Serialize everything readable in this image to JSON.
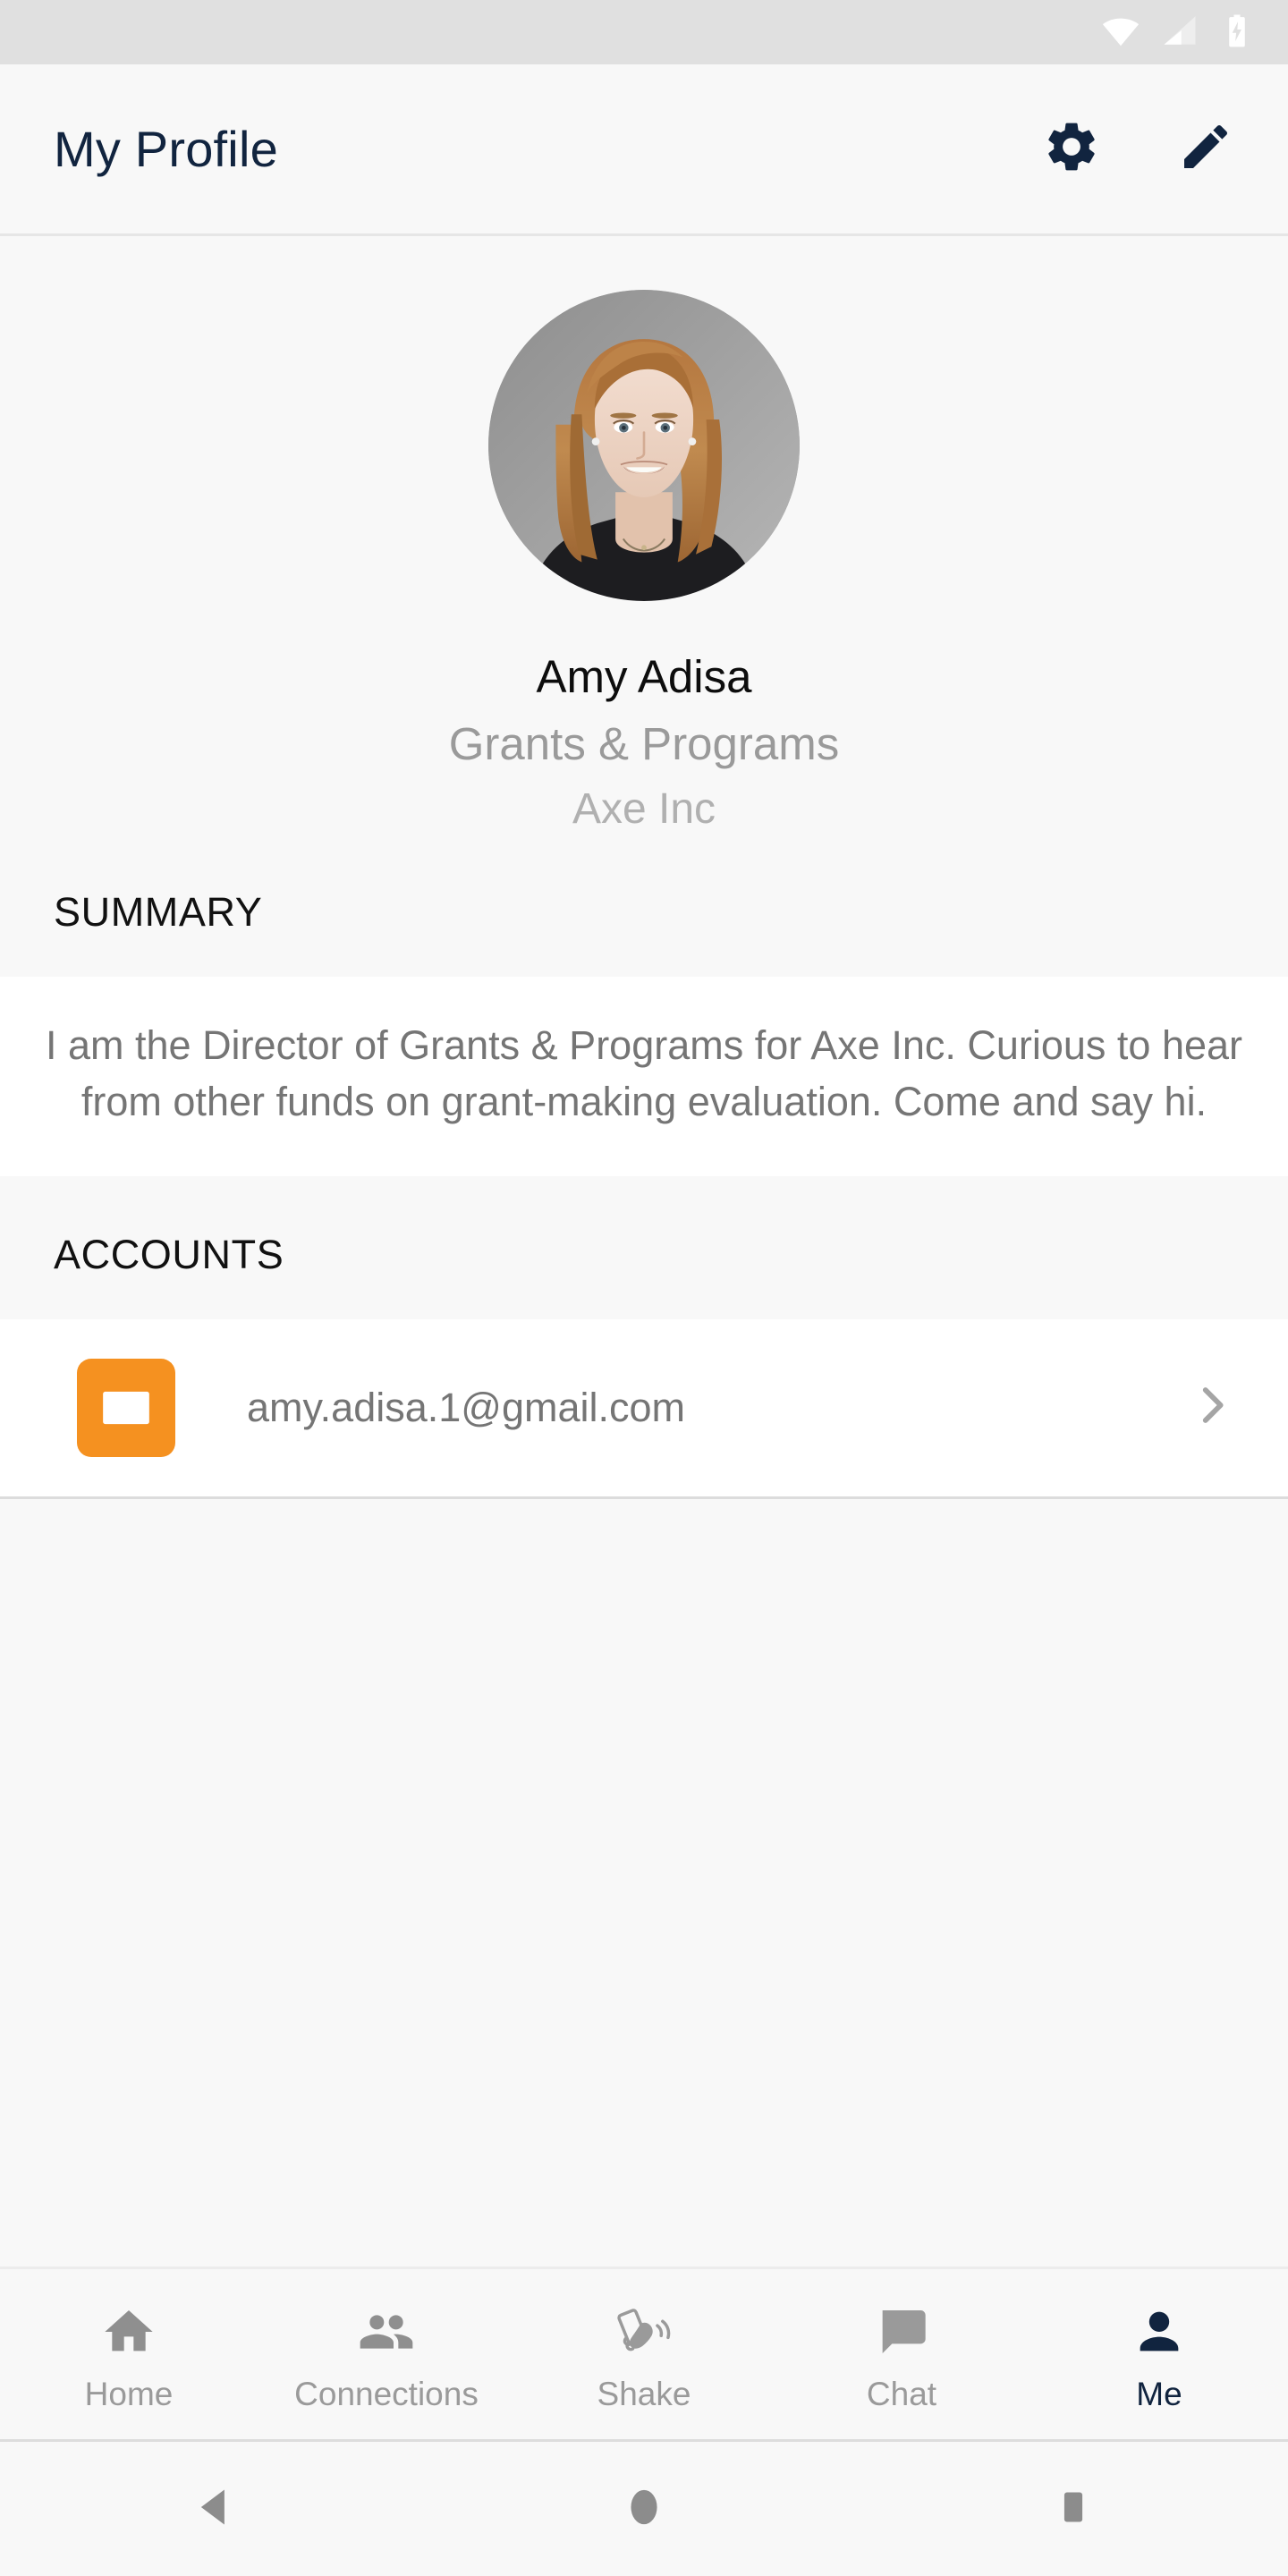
{
  "status_bar": {
    "icons": [
      "wifi-icon",
      "cellular-signal-icon",
      "battery-charging-icon"
    ]
  },
  "app_bar": {
    "title": "My Profile",
    "actions": [
      {
        "name": "settings-button",
        "icon": "gear-icon"
      },
      {
        "name": "edit-button",
        "icon": "pencil-icon"
      }
    ]
  },
  "profile": {
    "avatar_alt": "profile-photo",
    "name": "Amy Adisa",
    "role": "Grants & Programs",
    "company": "Axe Inc"
  },
  "summary": {
    "header": "SUMMARY",
    "body": "I am the Director of Grants & Programs for Axe Inc. Curious to hear from other funds on grant-making evaluation. Come and say hi."
  },
  "accounts": {
    "header": "ACCOUNTS",
    "items": [
      {
        "icon": "email-icon",
        "icon_color": "#f59120",
        "label": "amy.adisa.1@gmail.com",
        "chevron": "chevron-right-icon"
      }
    ]
  },
  "tab_bar": {
    "active_color": "#11243f",
    "inactive_color": "#9a9a9a",
    "tabs": [
      {
        "label": "Home",
        "icon": "home-icon",
        "active": false
      },
      {
        "label": "Connections",
        "icon": "people-icon",
        "active": false
      },
      {
        "label": "Shake",
        "icon": "shake-phone-icon",
        "active": false
      },
      {
        "label": "Chat",
        "icon": "chat-bubble-icon",
        "active": false
      },
      {
        "label": "Me",
        "icon": "person-icon",
        "active": true
      }
    ]
  },
  "system_nav": {
    "buttons": [
      "back-triangle-icon",
      "home-circle-icon",
      "recents-square-icon"
    ]
  }
}
